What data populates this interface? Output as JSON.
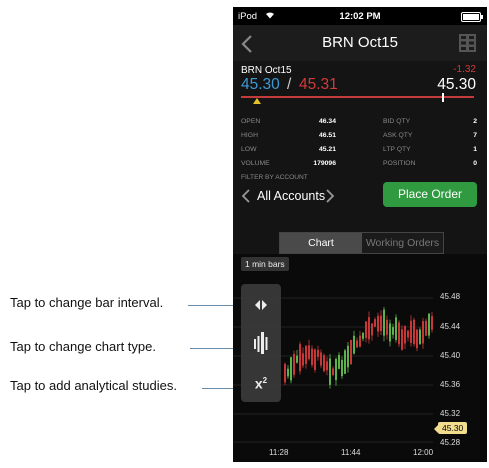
{
  "callouts": {
    "interval": "Tap to change bar interval.",
    "type": "Tap to change chart type.",
    "studies": "Tap to add analytical studies."
  },
  "status_bar": {
    "carrier": "iPod",
    "time": "12:02 PM"
  },
  "nav": {
    "title": "BRN Oct15"
  },
  "quote": {
    "symbol": "BRN Oct15",
    "bid": "45.30",
    "separator": "/",
    "ask": "45.31",
    "change": "-1.32",
    "last": "45.30"
  },
  "stats": {
    "open_label": "OPEN",
    "open": "46.34",
    "high_label": "HIGH",
    "high": "46.51",
    "low_label": "LOW",
    "low": "45.21",
    "volume_label": "VOLUME",
    "volume": "179096",
    "bid_qty_label": "BID QTY",
    "bid_qty": "2",
    "ask_qty_label": "ASK QTY",
    "ask_qty": "7",
    "ltp_qty_label": "LTP QTY",
    "ltp_qty": "1",
    "position_label": "POSITION",
    "position": "0"
  },
  "filter": {
    "label": "FILTER BY ACCOUNT",
    "account": "All Accounts"
  },
  "place_order": "Place Order",
  "tabs": {
    "chart": "Chart",
    "working_orders": "Working Orders"
  },
  "chart": {
    "bar_interval": "1 min bars",
    "price_labels": [
      "45.48",
      "45.44",
      "45.40",
      "45.36",
      "45.32",
      "45.28"
    ],
    "time_labels": [
      "11:28",
      "11:44",
      "12:00"
    ],
    "last_price": "45.30",
    "colors": {
      "up": "#5db34a",
      "down": "#c83737",
      "grid": "#222222"
    },
    "icons": [
      "interval-arrows-icon",
      "chart-type-icon",
      "studies-x-squared-icon"
    ],
    "studies_glyph": "x"
  }
}
